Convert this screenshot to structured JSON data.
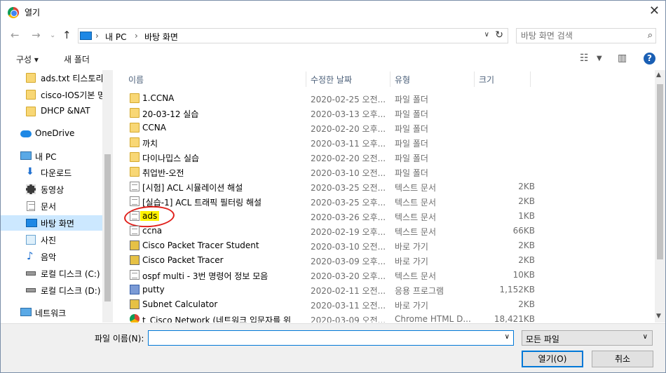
{
  "window": {
    "title": "열기"
  },
  "nav": {
    "breadcrumb": [
      "내 PC",
      "바탕 화면"
    ],
    "search_placeholder": "바탕 화면 검색"
  },
  "toolbar": {
    "organize": "구성 ▾",
    "new_folder": "새 폴더"
  },
  "sidebar": {
    "items": [
      {
        "label": "ads.txt 티스토리 ^",
        "icon": "folder-icon"
      },
      {
        "label": "cisco-IOS기본 명",
        "icon": "folder-icon"
      },
      {
        "label": "DHCP &NAT",
        "icon": "folder-icon"
      },
      {
        "label": "OneDrive",
        "icon": "cloud-icon"
      },
      {
        "label": "내 PC",
        "icon": "computer-icon"
      },
      {
        "label": "다운로드",
        "icon": "download-icon"
      },
      {
        "label": "동영상",
        "icon": "video-icon"
      },
      {
        "label": "문서",
        "icon": "document-icon"
      },
      {
        "label": "바탕 화면",
        "icon": "desktop-icon"
      },
      {
        "label": "사진",
        "icon": "pictures-icon"
      },
      {
        "label": "음악",
        "icon": "music-icon"
      },
      {
        "label": "로컬 디스크 (C:)",
        "icon": "drive-icon"
      },
      {
        "label": "로컬 디스크 (D:)",
        "icon": "drive-icon"
      },
      {
        "label": "네트워크",
        "icon": "network-icon"
      }
    ]
  },
  "columns": {
    "name": "이름",
    "date": "수정한 날짜",
    "type": "유형",
    "size": "크기"
  },
  "files": [
    {
      "name": "1.CCNA",
      "date": "2020-02-25 오전...",
      "type": "파일 폴더",
      "size": "",
      "icon": "folder-icon"
    },
    {
      "name": "20-03-12 실습",
      "date": "2020-03-13 오후...",
      "type": "파일 폴더",
      "size": "",
      "icon": "folder-icon"
    },
    {
      "name": "CCNA",
      "date": "2020-02-20 오후...",
      "type": "파일 폴더",
      "size": "",
      "icon": "folder-icon"
    },
    {
      "name": "까치",
      "date": "2020-03-11 오후...",
      "type": "파일 폴더",
      "size": "",
      "icon": "folder-icon"
    },
    {
      "name": "다이나밉스 실습",
      "date": "2020-02-20 오전...",
      "type": "파일 폴더",
      "size": "",
      "icon": "folder-icon"
    },
    {
      "name": "취업반-오전",
      "date": "2020-03-10 오전...",
      "type": "파일 폴더",
      "size": "",
      "icon": "folder-icon"
    },
    {
      "name": "[시험] ACL 시뮬레이션 해설",
      "date": "2020-03-25 오전...",
      "type": "텍스트 문서",
      "size": "2KB",
      "icon": "text-file-icon"
    },
    {
      "name": "[실습-1] ACL 트래픽 필터링 해설",
      "date": "2020-03-25 오후...",
      "type": "텍스트 문서",
      "size": "2KB",
      "icon": "text-file-icon"
    },
    {
      "name": "ads",
      "date": "2020-03-26 오후...",
      "type": "텍스트 문서",
      "size": "1KB",
      "icon": "text-file-icon"
    },
    {
      "name": "ccna",
      "date": "2020-02-19 오후...",
      "type": "텍스트 문서",
      "size": "66KB",
      "icon": "text-file-icon"
    },
    {
      "name": "Cisco Packet Tracer Student",
      "date": "2020-03-10 오전...",
      "type": "바로 가기",
      "size": "2KB",
      "icon": "shortcut-icon"
    },
    {
      "name": "Cisco Packet Tracer",
      "date": "2020-03-09 오후...",
      "type": "바로 가기",
      "size": "2KB",
      "icon": "shortcut-icon"
    },
    {
      "name": "ospf multi - 3번 명령어 정보 모음",
      "date": "2020-03-20 오후...",
      "type": "텍스트 문서",
      "size": "10KB",
      "icon": "text-file-icon"
    },
    {
      "name": "putty",
      "date": "2020-02-11 오전...",
      "type": "응용 프로그램",
      "size": "1,152KB",
      "icon": "application-icon"
    },
    {
      "name": "Subnet Calculator",
      "date": "2020-03-11 오전...",
      "type": "바로 가기",
      "size": "2KB",
      "icon": "shortcut-icon"
    },
    {
      "name": "t_Cisco Network (네트워크 입문자를 위",
      "date": "2020-03-09 오전...",
      "type": "Chrome HTML D...",
      "size": "18,421KB",
      "icon": "chrome-icon"
    }
  ],
  "bottom": {
    "filename_label": "파일 이름(N):",
    "filename_value": "",
    "filter_value": "모든 파일",
    "open_label": "열기(O)",
    "cancel_label": "취소"
  },
  "highlight_color": "#fff200",
  "annotation_color": "#e0201b"
}
